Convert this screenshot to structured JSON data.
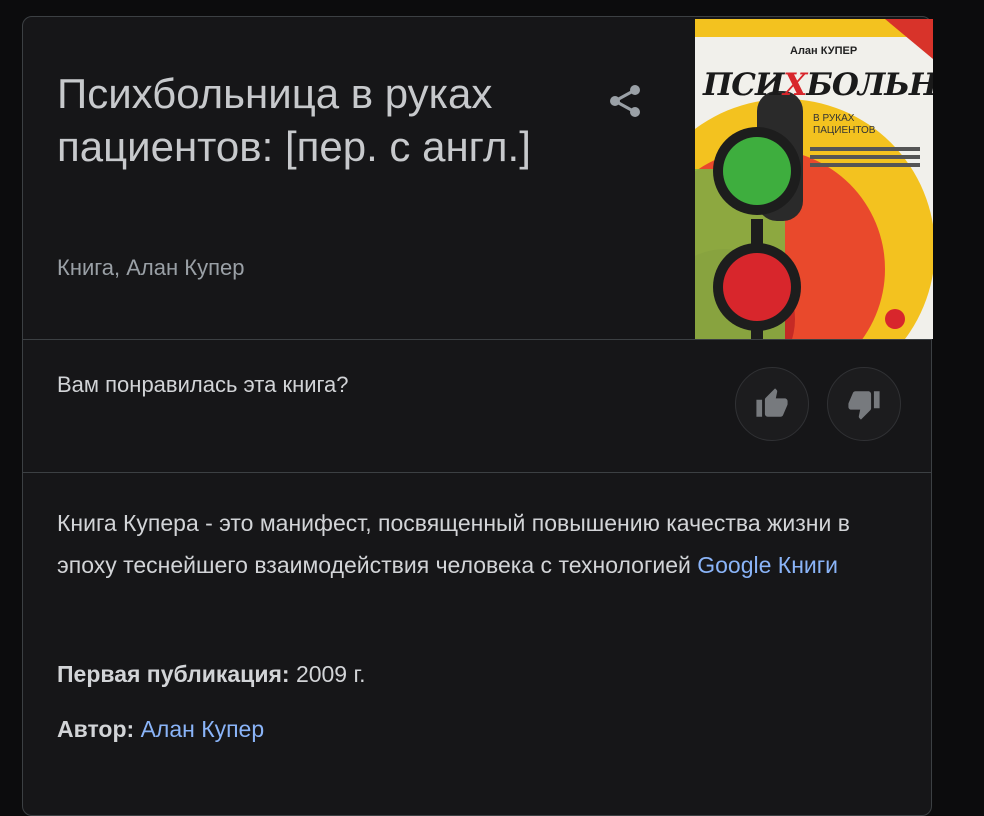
{
  "book": {
    "title": "Психбольница в руках пациентов: [пер. с англ.]",
    "subtitle": "Книга, Алан Купер"
  },
  "cover": {
    "author": "Алан КУПЕР",
    "title_left": "ПСИ",
    "title_x": "Х",
    "title_right": "БОЛЬНИЦА",
    "subtitle_line1": "В РУКАХ",
    "subtitle_line2": "ПАЦИЕНТОВ"
  },
  "rating": {
    "question": "Вам понравилась эта книга?",
    "like_icon": "thumbs-up-icon",
    "dislike_icon": "thumbs-down-icon"
  },
  "description": {
    "text": "Книга Купера - это манифест, посвященный повышению качества жизни в эпоху теснейшего взаимодействия человека с технологией",
    "source_link": "Google Книги"
  },
  "facts": {
    "first_published_label": "Первая публикация:",
    "first_published_value": "2009 г.",
    "author_label": "Автор:",
    "author_value": "Алан Купер"
  },
  "colors": {
    "panel_bg": "#161618",
    "text": "#d2d4d7",
    "muted": "#9aa0a6",
    "link": "#8ab4f8"
  }
}
